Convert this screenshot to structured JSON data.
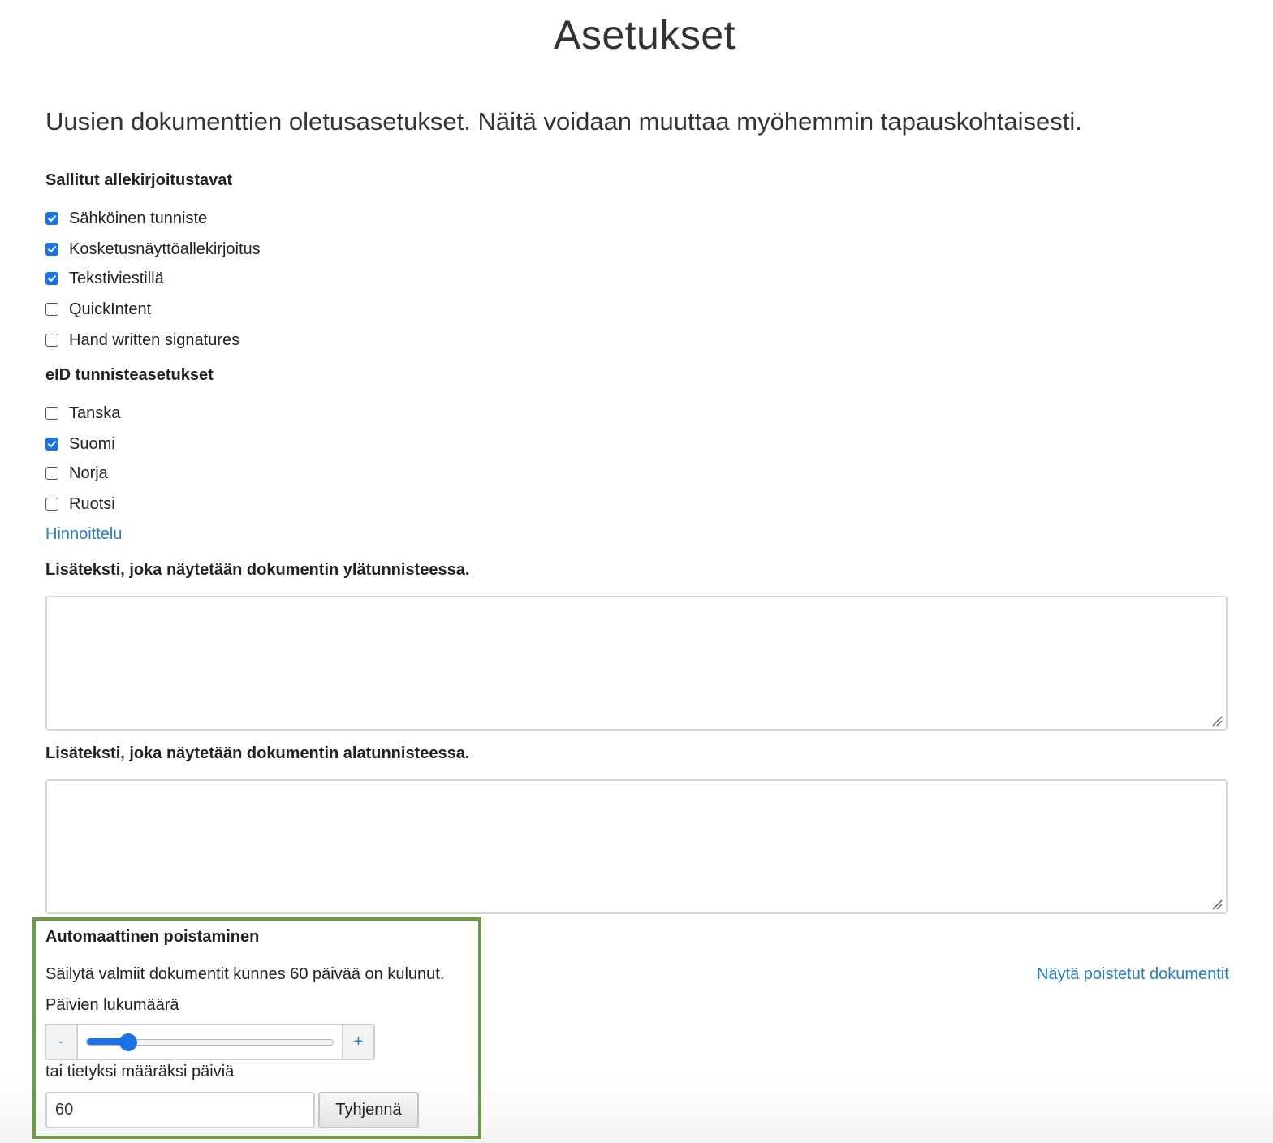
{
  "page": {
    "title": "Asetukset",
    "intro": "Uusien dokumenttien oletusasetukset. Näitä voidaan muuttaa myöhemmin tapauskohtaisesti."
  },
  "signature_methods": {
    "heading": "Sallitut allekirjoitustavat",
    "options": [
      {
        "label": "Sähköinen tunniste",
        "checked": true
      },
      {
        "label": "Kosketusnäyttöallekirjoitus",
        "checked": true
      },
      {
        "label": "Tekstiviestillä",
        "checked": true
      },
      {
        "label": "QuickIntent",
        "checked": false
      },
      {
        "label": "Hand written signatures",
        "checked": false
      }
    ]
  },
  "eid_settings": {
    "heading": "eID tunnisteasetukset",
    "options": [
      {
        "label": "Tanska",
        "checked": false
      },
      {
        "label": "Suomi",
        "checked": true
      },
      {
        "label": "Norja",
        "checked": false
      },
      {
        "label": "Ruotsi",
        "checked": false
      }
    ],
    "pricing_link": "Hinnoittelu"
  },
  "header_text": {
    "label": "Lisäteksti, joka näytetään dokumentin ylätunnisteessa.",
    "value": ""
  },
  "footer_text": {
    "label": "Lisäteksti, joka näytetään dokumentin alatunnisteessa.",
    "value": ""
  },
  "auto_delete": {
    "heading": "Automaattinen poistaminen",
    "description": "Säilytä valmiit dokumentit kunnes 60 päivää on kulunut.",
    "days_label": "Päivien lukumäärä",
    "minus_label": "-",
    "plus_label": "+",
    "slider_fraction": 0.17,
    "or_label": "tai tietyksi määräksi päiviä",
    "days_value": "60",
    "clear_label": "Tyhjennä",
    "show_deleted_link": "Näytä poistetut dokumentit",
    "highlight_color": "#6e9a45"
  },
  "colors": {
    "accent": "#1a73e8",
    "link": "#2a7ec0"
  }
}
